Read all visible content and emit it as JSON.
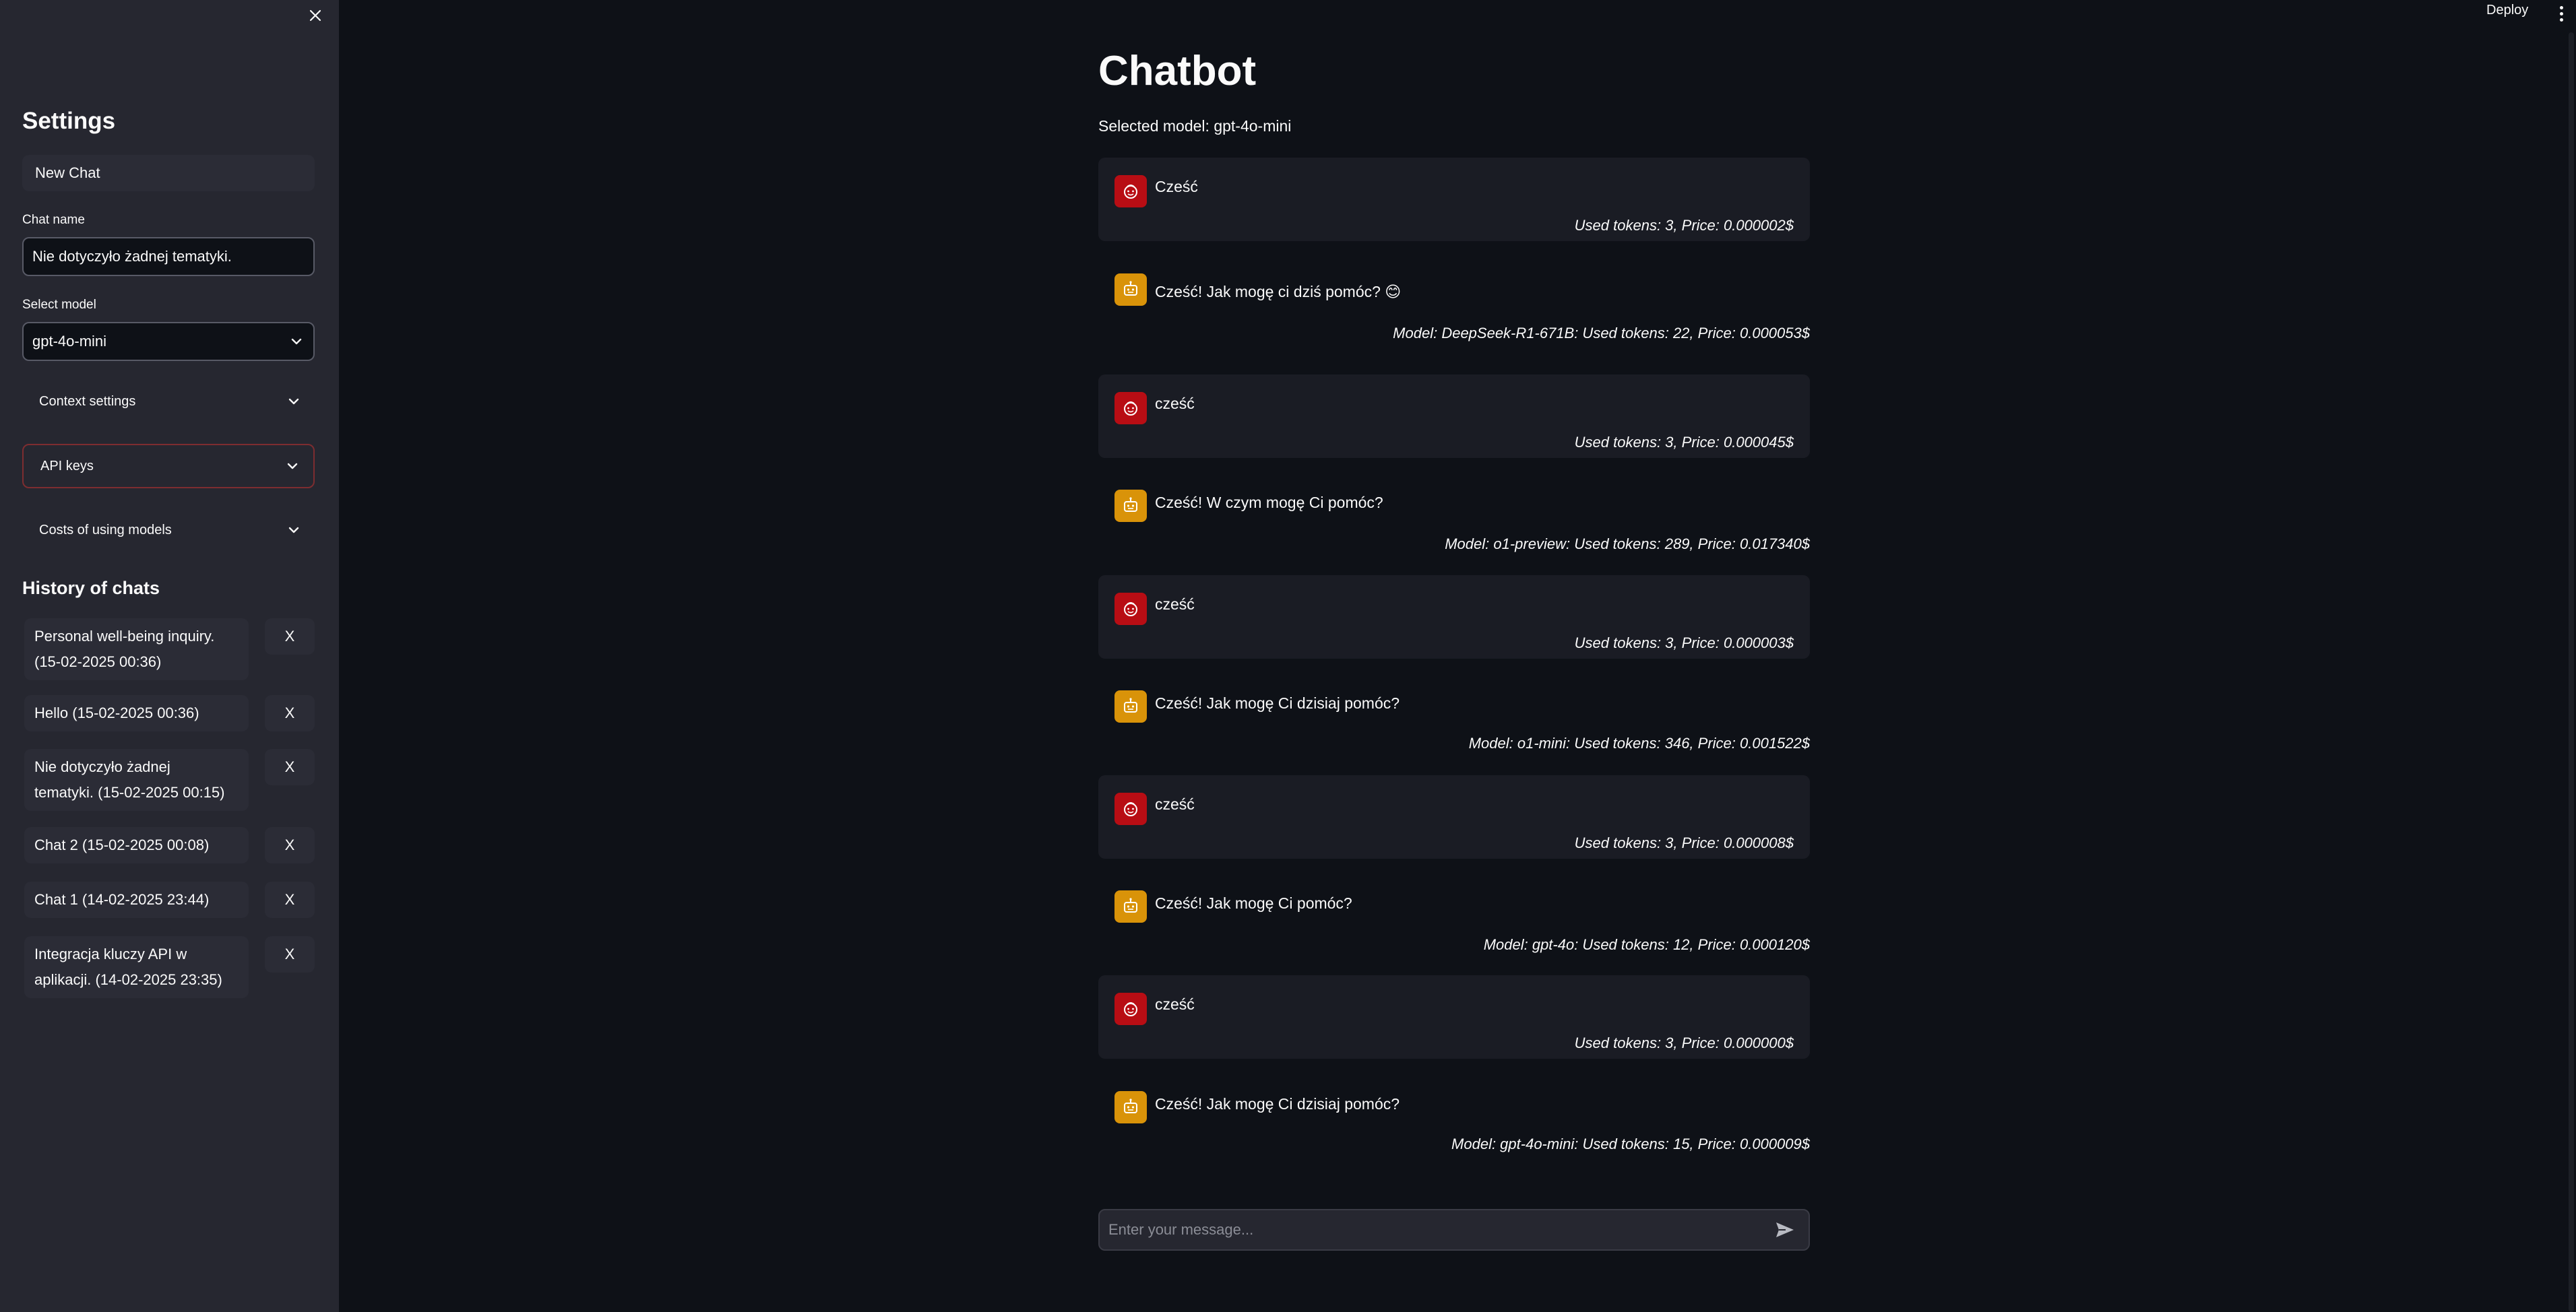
{
  "sidebar": {
    "title": "Settings",
    "new_chat_label": "New Chat",
    "chat_name_label": "Chat name",
    "chat_name_value": "Nie dotyczyło żadnej tematyki.",
    "select_model_label": "Select model",
    "select_model_value": "gpt-4o-mini",
    "expanders": {
      "context": "Context settings",
      "api_keys": "API keys",
      "costs": "Costs of using models"
    },
    "history_title": "History of chats",
    "history": [
      {
        "line1": "Personal well-being inquiry.",
        "line2": "(15-02-2025 00:36)",
        "delete": "X"
      },
      {
        "line1": "Hello (15-02-2025 00:36)",
        "line2": "",
        "delete": "X"
      },
      {
        "line1": "Nie dotyczyło żadnej",
        "line2": "tematyki. (15-02-2025 00:15)",
        "delete": "X"
      },
      {
        "line1": "Chat 2 (15-02-2025 00:08)",
        "line2": "",
        "delete": "X"
      },
      {
        "line1": "Chat 1 (14-02-2025 23:44)",
        "line2": "",
        "delete": "X"
      },
      {
        "line1": "Integracja kluczy API w",
        "line2": "aplikacji. (14-02-2025 23:35)",
        "delete": "X"
      }
    ]
  },
  "header": {
    "deploy_label": "Deploy",
    "menu_icon": "more-vertical-icon"
  },
  "main": {
    "title": "Chatbot",
    "selected_model": "Selected model: gpt-4o-mini",
    "messages": [
      {
        "role": "user",
        "text": "Cześć",
        "meta": "Used tokens: 3, Price: 0.000002$"
      },
      {
        "role": "assistant",
        "text": "Cześć! Jak mogę ci dziś pomóc? 😊",
        "meta": "Model: DeepSeek-R1-671B: Used tokens: 22, Price: 0.000053$"
      },
      {
        "role": "user",
        "text": "cześć",
        "meta": "Used tokens: 3, Price: 0.000045$"
      },
      {
        "role": "assistant",
        "text": "Cześć! W czym mogę Ci pomóc?",
        "meta": "Model: o1-preview: Used tokens: 289, Price: 0.017340$"
      },
      {
        "role": "user",
        "text": "cześć",
        "meta": "Used tokens: 3, Price: 0.000003$"
      },
      {
        "role": "assistant",
        "text": "Cześć! Jak mogę Ci dzisiaj pomóc?",
        "meta": "Model: o1-mini: Used tokens: 346, Price: 0.001522$"
      },
      {
        "role": "user",
        "text": "cześć",
        "meta": "Used tokens: 3, Price: 0.000008$"
      },
      {
        "role": "assistant",
        "text": "Cześć! Jak mogę Ci pomóc?",
        "meta": "Model: gpt-4o: Used tokens: 12, Price: 0.000120$"
      },
      {
        "role": "user",
        "text": "cześć",
        "meta": "Used tokens: 3, Price: 0.000000$"
      },
      {
        "role": "assistant",
        "text": "Cześć! Jak mogę Ci dzisiaj pomóc?",
        "meta": "Model: gpt-4o-mini: Used tokens: 15, Price: 0.000009$"
      }
    ],
    "input_placeholder": "Enter your message..."
  },
  "colors": {
    "user_avatar": "#b80d14",
    "assistant_avatar": "#d99309",
    "sidebar_bg": "#262730",
    "main_bg": "#0e1117"
  }
}
